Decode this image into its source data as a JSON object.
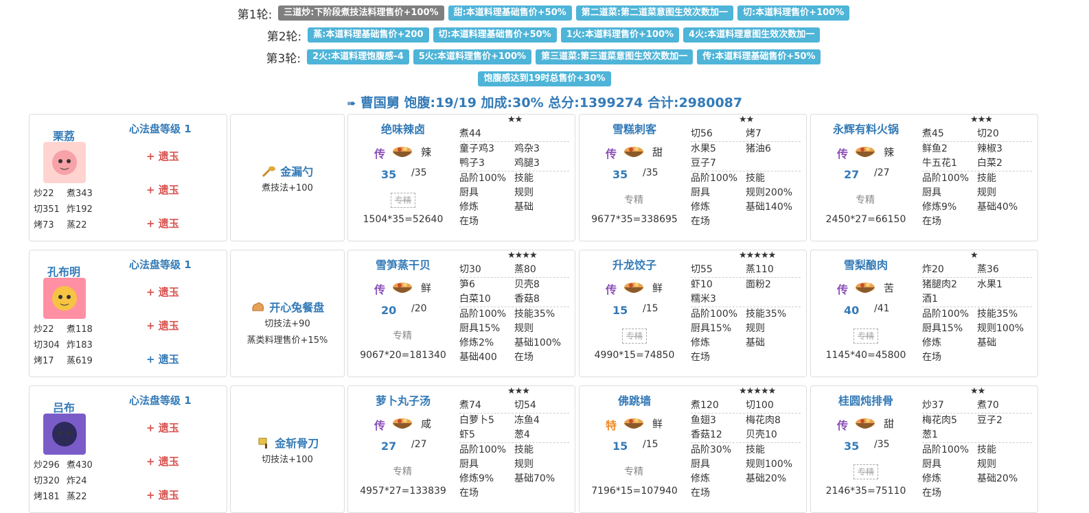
{
  "rounds": [
    {
      "label": "第1轮:",
      "tags": [
        {
          "text": "三道炒:下阶段煮技法料理售价+100%",
          "gray": true
        },
        {
          "text": "甜:本道料理基础售价+50%"
        },
        {
          "text": "第二道菜:第二道菜意图生效次数加一"
        },
        {
          "text": "切:本道料理售价+100%"
        }
      ]
    },
    {
      "label": "第2轮:",
      "tags": [
        {
          "text": "蒸:本道料理基础售价+200"
        },
        {
          "text": "切:本道料理基础售价+50%"
        },
        {
          "text": "1火:本道料理售价+100%"
        },
        {
          "text": "4火:本道料理意图生效次数加一"
        }
      ]
    },
    {
      "label": "第3轮:",
      "tags": [
        {
          "text": "2火:本道料理饱腹感-4"
        },
        {
          "text": "5火:本道料理售价+100%"
        },
        {
          "text": "第三道菜:第三道菜意图生效次数加一"
        },
        {
          "text": "传:本道料理基础售价+50%"
        }
      ]
    }
  ],
  "extra_tag": "饱腹感达到19时总售价+30%",
  "summary": "曹国舅 饱腹:19/19 加成:30% 总分:1399274 合计:2980087",
  "colors": {
    "tag": "#4eb4d8",
    "tag_gray": "#7f7f7f",
    "link": "#337ab7",
    "jade_red": "#d9534f",
    "rarity_purple": "#8a4fb8",
    "rarity_orange": "#f08a24"
  },
  "rows": [
    {
      "chef": {
        "name": "栗荔",
        "disc": "心法盘等级 1",
        "jades": [
          {
            "text": "+ 遗玉",
            "blue": false
          },
          {
            "text": "+ 遗玉",
            "blue": false
          },
          {
            "text": "+ 遗玉",
            "blue": false
          }
        ],
        "skills": [
          "炒22",
          "煮343",
          "切351",
          "炸192",
          "烤73",
          "蒸22"
        ]
      },
      "equip": {
        "icon": "ladle-icon",
        "name": "金漏勺",
        "desc": [
          "煮技法+100"
        ]
      },
      "dishes": [
        {
          "name": "绝味辣卤",
          "stars": "★★",
          "rarity": "传",
          "taste": "辣",
          "qty": "35",
          "qmax": "/35",
          "spec": "专精",
          "spec_strike": true,
          "score": "1504*35=52640",
          "sections": [
            [
              "煮44",
              ""
            ],
            [
              "童子鸡3",
              "鸡杂3",
              "鸭子3",
              "鸡腿3"
            ],
            [
              "品阶100%",
              "技能",
              "厨具",
              "规则",
              "修炼",
              "基础",
              "在场",
              ""
            ]
          ]
        },
        {
          "name": "雪糕刺客",
          "stars": "★★",
          "rarity": "传",
          "taste": "甜",
          "qty": "35",
          "qmax": "/35",
          "spec": "专精",
          "spec_strike": false,
          "score": "9677*35=338695",
          "sections": [
            [
              "切56",
              "烤7"
            ],
            [
              "水果5",
              "猪油6",
              "豆子7",
              ""
            ],
            [
              "品阶100%",
              "技能",
              "厨具",
              "规则200%",
              "修炼",
              "基础140%",
              "在场",
              ""
            ]
          ]
        },
        {
          "name": "永辉有料火锅",
          "stars": "★★★",
          "rarity": "传",
          "taste": "辣",
          "qty": "27",
          "qmax": "/27",
          "spec": "专精",
          "spec_strike": false,
          "score": "2450*27=66150",
          "sections": [
            [
              "煮45",
              "切20"
            ],
            [
              "鲜鱼2",
              "辣椒3",
              "牛五花1",
              "白菜2"
            ],
            [
              "品阶100%",
              "技能",
              "厨具",
              "规则",
              "修炼9%",
              "基础40%",
              "在场",
              ""
            ]
          ]
        }
      ]
    },
    {
      "chef": {
        "name": "孔布明",
        "disc": "心法盘等级 1",
        "jades": [
          {
            "text": "+ 遗玉",
            "blue": false
          },
          {
            "text": "+ 遗玉",
            "blue": false
          },
          {
            "text": "+ 遗玉",
            "blue": true
          }
        ],
        "skills": [
          "炒22",
          "煮118",
          "切304",
          "炸183",
          "烤17",
          "蒸619"
        ]
      },
      "equip": {
        "icon": "mitten-icon",
        "name": "开心兔餐盘",
        "desc": [
          "切技法+90",
          "蒸类料理售价+15%"
        ]
      },
      "dishes": [
        {
          "name": "雪笋蒸干贝",
          "stars": "★★★★",
          "rarity": "传",
          "taste": "鲜",
          "qty": "20",
          "qmax": "/20",
          "spec": "专精",
          "spec_strike": false,
          "score": "9067*20=181340",
          "sections": [
            [
              "切30",
              "蒸80"
            ],
            [
              "笋6",
              "贝壳8",
              "白菜10",
              "香菇8"
            ],
            [
              "品阶100%",
              "技能35%",
              "厨具15%",
              "规则",
              "修炼2%",
              "基础100%",
              "基础400",
              "在场"
            ]
          ]
        },
        {
          "name": "升龙饺子",
          "stars": "★★★★★",
          "rarity": "传",
          "taste": "鲜",
          "qty": "15",
          "qmax": "/15",
          "spec": "专精",
          "spec_strike": true,
          "score": "4990*15=74850",
          "sections": [
            [
              "切55",
              "蒸110"
            ],
            [
              "虾10",
              "面粉2",
              "糯米3",
              ""
            ],
            [
              "品阶100%",
              "技能35%",
              "厨具15%",
              "规则",
              "修炼",
              "基础",
              "在场",
              ""
            ]
          ]
        },
        {
          "name": "雪梨酿肉",
          "stars": "★",
          "rarity": "传",
          "taste": "苦",
          "qty": "40",
          "qmax": "/41",
          "spec": "专精",
          "spec_strike": true,
          "score": "1145*40=45800",
          "sections": [
            [
              "炸20",
              "蒸36"
            ],
            [
              "猪腿肉2",
              "水果1",
              "酒1",
              ""
            ],
            [
              "品阶100%",
              "技能35%",
              "厨具15%",
              "规则100%",
              "修炼",
              "基础",
              "在场",
              ""
            ]
          ]
        }
      ]
    },
    {
      "chef": {
        "name": "吕布",
        "disc": "心法盘等级 1",
        "jades": [
          {
            "text": "+ 遗玉",
            "blue": false
          },
          {
            "text": "+ 遗玉",
            "blue": false
          },
          {
            "text": "+ 遗玉",
            "blue": false
          }
        ],
        "skills": [
          "炒296",
          "煮430",
          "切320",
          "炸24",
          "烤181",
          "蒸22"
        ]
      },
      "equip": {
        "icon": "cleaver-icon",
        "name": "金斩骨刀",
        "desc": [
          "切技法+100"
        ]
      },
      "dishes": [
        {
          "name": "萝卜丸子汤",
          "stars": "★★★",
          "rarity": "传",
          "taste": "咸",
          "qty": "27",
          "qmax": "/27",
          "spec": "专精",
          "spec_strike": false,
          "score": "4957*27=133839",
          "sections": [
            [
              "煮74",
              "切54"
            ],
            [
              "白萝卜5",
              "冻鱼4",
              "虾5",
              "葱4"
            ],
            [
              "品阶100%",
              "技能",
              "厨具",
              "规则",
              "修炼9%",
              "基础70%",
              "在场",
              ""
            ]
          ]
        },
        {
          "name": "佛跳墙",
          "stars": "★★★★★",
          "rarity": "特",
          "taste": "鲜",
          "qty": "15",
          "qmax": "/15",
          "spec": "专精",
          "spec_strike": false,
          "score": "7196*15=107940",
          "sections": [
            [
              "煮120",
              "切100"
            ],
            [
              "鱼翅3",
              "梅花肉8",
              "香菇12",
              "贝壳10"
            ],
            [
              "品阶30%",
              "技能",
              "厨具",
              "规则100%",
              "修炼",
              "基础20%",
              "在场",
              ""
            ]
          ]
        },
        {
          "name": "桂圆炖排骨",
          "stars": "★★",
          "rarity": "传",
          "taste": "甜",
          "qty": "35",
          "qmax": "/35",
          "spec": "专精",
          "spec_strike": true,
          "score": "2146*35=75110",
          "sections": [
            [
              "炒37",
              "煮70"
            ],
            [
              "梅花肉5",
              "豆子2",
              "葱1",
              ""
            ],
            [
              "品阶100%",
              "技能",
              "厨具",
              "规则",
              "修炼",
              "基础20%",
              "在场",
              ""
            ]
          ]
        }
      ]
    }
  ]
}
